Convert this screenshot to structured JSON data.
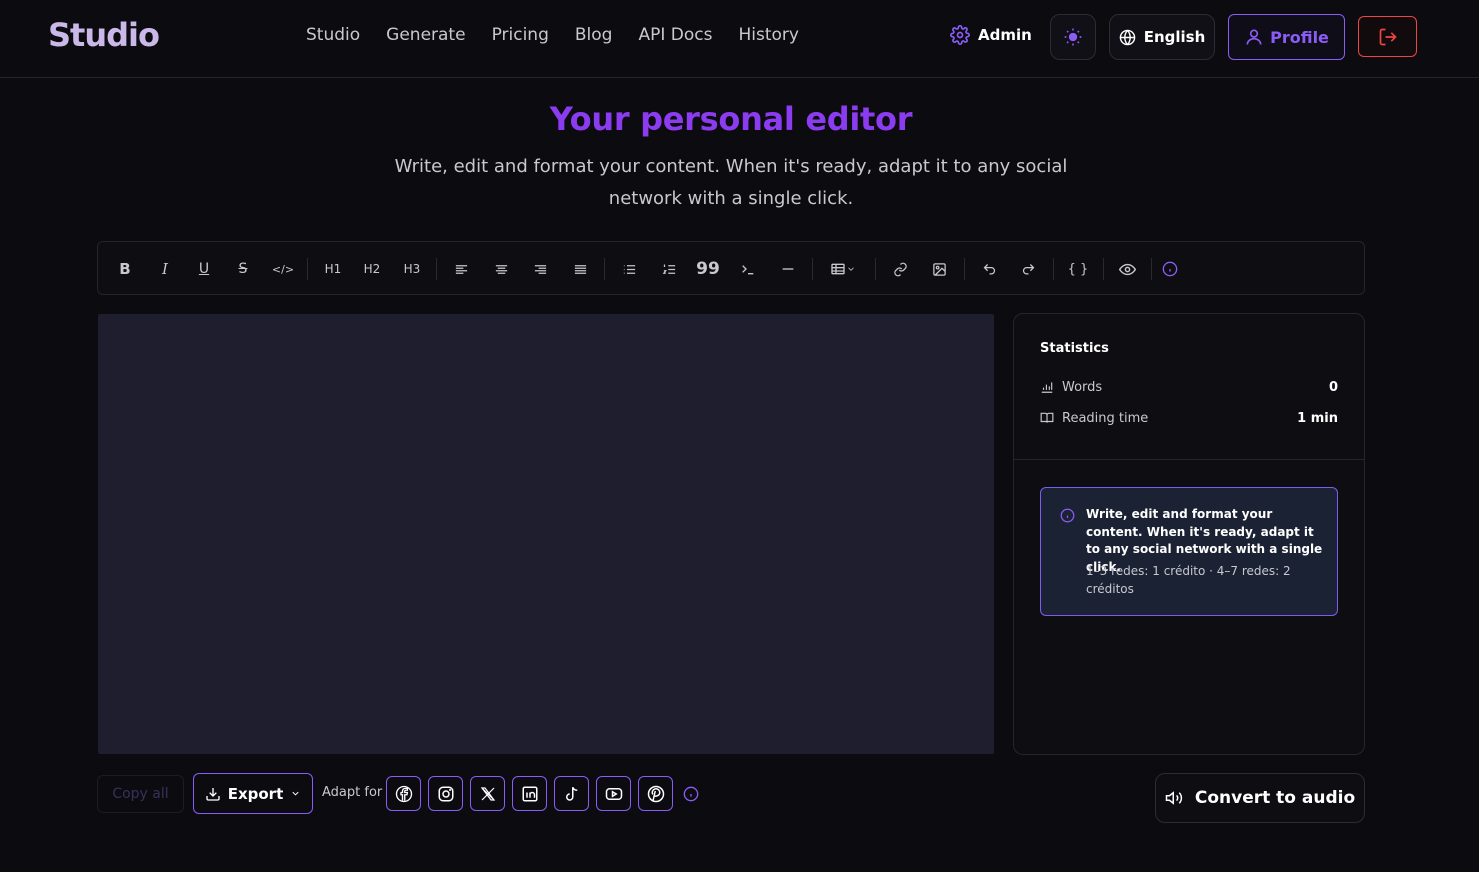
{
  "header": {
    "logo": "Studio",
    "nav": [
      "Studio",
      "Generate",
      "Pricing",
      "Blog",
      "API Docs",
      "History"
    ],
    "admin_label": "Admin",
    "language_label": "English",
    "profile_label": "Profile",
    "accent_color": "#8b5cf6",
    "logout_color": "#ef4444"
  },
  "hero": {
    "title": "Your personal editor",
    "subtitle": "Write, edit and format your content. When it's ready, adapt it to any social network with a single click."
  },
  "toolbar": {
    "buttons": [
      "bold-icon",
      "italic-icon",
      "underline-icon",
      "strikethrough-icon",
      "code-icon",
      "h1",
      "h2",
      "h3",
      "align-left-icon",
      "align-center-icon",
      "align-right-icon",
      "align-justify-icon",
      "bullet-list-icon",
      "ordered-list-icon",
      "quote-icon",
      "terminal-icon",
      "horizontal-rule-icon",
      "table-icon",
      "link-icon",
      "image-icon",
      "undo-icon",
      "redo-icon",
      "braces-icon",
      "eye-icon",
      "info-icon"
    ],
    "h1": "H1",
    "h2": "H2",
    "h3": "H3",
    "braces": "{ }"
  },
  "stats": {
    "title": "Statistics",
    "words_label": "Words",
    "words_value": "0",
    "reading_label": "Reading time",
    "reading_value": "1 min",
    "info_strong": "Write, edit and format your content. When it's ready, adapt it to any social network with a single click.",
    "info_small": "1–3 redes: 1 crédito · 4–7 redes: 2 créditos"
  },
  "bottom": {
    "copy_label": "Copy all",
    "export_label": "Export",
    "adapt_label": "Adapt for",
    "socials": [
      "facebook-icon",
      "instagram-icon",
      "x-icon",
      "linkedin-icon",
      "tiktok-icon",
      "youtube-icon",
      "pinterest-icon"
    ],
    "audio_label": "Convert to audio"
  }
}
